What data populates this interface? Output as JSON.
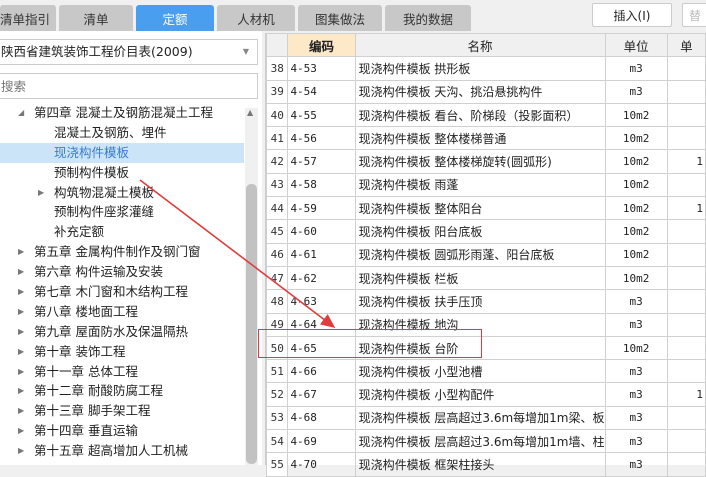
{
  "tabs": [
    {
      "label": "清单指引"
    },
    {
      "label": "清单"
    },
    {
      "label": "定额",
      "active": true
    },
    {
      "label": "人材机"
    },
    {
      "label": "图集做法"
    },
    {
      "label": "我的数据"
    }
  ],
  "toolbar": {
    "insert_label": "插入(I)",
    "next_label": "替"
  },
  "library": {
    "selected": "陕西省建筑装饰工程价目表(2009)",
    "search_placeholder": "搜索"
  },
  "tree": [
    {
      "label": "第四章 混凝土及钢筋混凝土工程",
      "level": 0,
      "state": "expanded"
    },
    {
      "label": "混凝土及钢筋、埋件",
      "level": 1
    },
    {
      "label": "现浇构件模板",
      "level": 1,
      "selected": true
    },
    {
      "label": "预制构件模板",
      "level": 1
    },
    {
      "label": "构筑物混凝土模板",
      "level": 1,
      "state": "collapsed"
    },
    {
      "label": "预制构件座浆灌缝",
      "level": 1
    },
    {
      "label": "补充定额",
      "level": 1
    },
    {
      "label": "第五章 金属构件制作及钢门窗",
      "level": 0,
      "state": "collapsed"
    },
    {
      "label": "第六章 构件运输及安装",
      "level": 0,
      "state": "collapsed"
    },
    {
      "label": "第七章 木门窗和木结构工程",
      "level": 0,
      "state": "collapsed"
    },
    {
      "label": "第八章 楼地面工程",
      "level": 0,
      "state": "collapsed"
    },
    {
      "label": "第九章 屋面防水及保温隔热",
      "level": 0,
      "state": "collapsed"
    },
    {
      "label": "第十章 装饰工程",
      "level": 0,
      "state": "collapsed"
    },
    {
      "label": "第十一章 总体工程",
      "level": 0,
      "state": "collapsed"
    },
    {
      "label": "第十二章 耐酸防腐工程",
      "level": 0,
      "state": "collapsed"
    },
    {
      "label": "第十三章 脚手架工程",
      "level": 0,
      "state": "collapsed"
    },
    {
      "label": "第十四章 垂直运输",
      "level": 0,
      "state": "collapsed"
    },
    {
      "label": "第十五章 超高增加人工机械",
      "level": 0,
      "state": "collapsed"
    }
  ],
  "table": {
    "columns": [
      "",
      "编码",
      "名称",
      "单位",
      "单"
    ],
    "rows": [
      [
        "38",
        "4-53",
        "现浇构件模板 拱形板",
        "m3",
        ""
      ],
      [
        "39",
        "4-54",
        "现浇构件模板 天沟、挑沿悬挑构件",
        "m3",
        ""
      ],
      [
        "40",
        "4-55",
        "现浇构件模板 看台、阶梯段（投影面积）",
        "10m2",
        ""
      ],
      [
        "41",
        "4-56",
        "现浇构件模板 整体楼梯普通",
        "10m2",
        ""
      ],
      [
        "42",
        "4-57",
        "现浇构件模板 整体楼梯旋转(圆弧形)",
        "10m2",
        "1"
      ],
      [
        "43",
        "4-58",
        "现浇构件模板 雨蓬",
        "10m2",
        ""
      ],
      [
        "44",
        "4-59",
        "现浇构件模板 整体阳台",
        "10m2",
        "1"
      ],
      [
        "45",
        "4-60",
        "现浇构件模板 阳台底板",
        "10m2",
        ""
      ],
      [
        "46",
        "4-61",
        "现浇构件模板 圆弧形雨蓬、阳台底板",
        "10m2",
        ""
      ],
      [
        "47",
        "4-62",
        "现浇构件模板 栏板",
        "10m2",
        ""
      ],
      [
        "48",
        "4-63",
        "现浇构件模板 扶手压顶",
        "m3",
        ""
      ],
      [
        "49",
        "4-64",
        "现浇构件模板 地沟",
        "m3",
        ""
      ],
      [
        "50",
        "4-65",
        "现浇构件模板 台阶",
        "10m2",
        ""
      ],
      [
        "51",
        "4-66",
        "现浇构件模板 小型池槽",
        "m3",
        ""
      ],
      [
        "52",
        "4-67",
        "现浇构件模板 小型构配件",
        "m3",
        "1"
      ],
      [
        "53",
        "4-68",
        "现浇构件模板 层高超过3.6m每增加1m梁、板",
        "m3",
        ""
      ],
      [
        "54",
        "4-69",
        "现浇构件模板 层高超过3.6m每增加1m墙、柱",
        "m3",
        ""
      ],
      [
        "55",
        "4-70",
        "现浇构件模板 框架柱接头",
        "m3",
        ""
      ]
    ],
    "highlighted_row": "50"
  },
  "colors": {
    "active_tab": "#4a9ef0",
    "selection": "#cce4f7",
    "annotation": "#e23b3b",
    "header_highlight": "#fde8c8"
  }
}
